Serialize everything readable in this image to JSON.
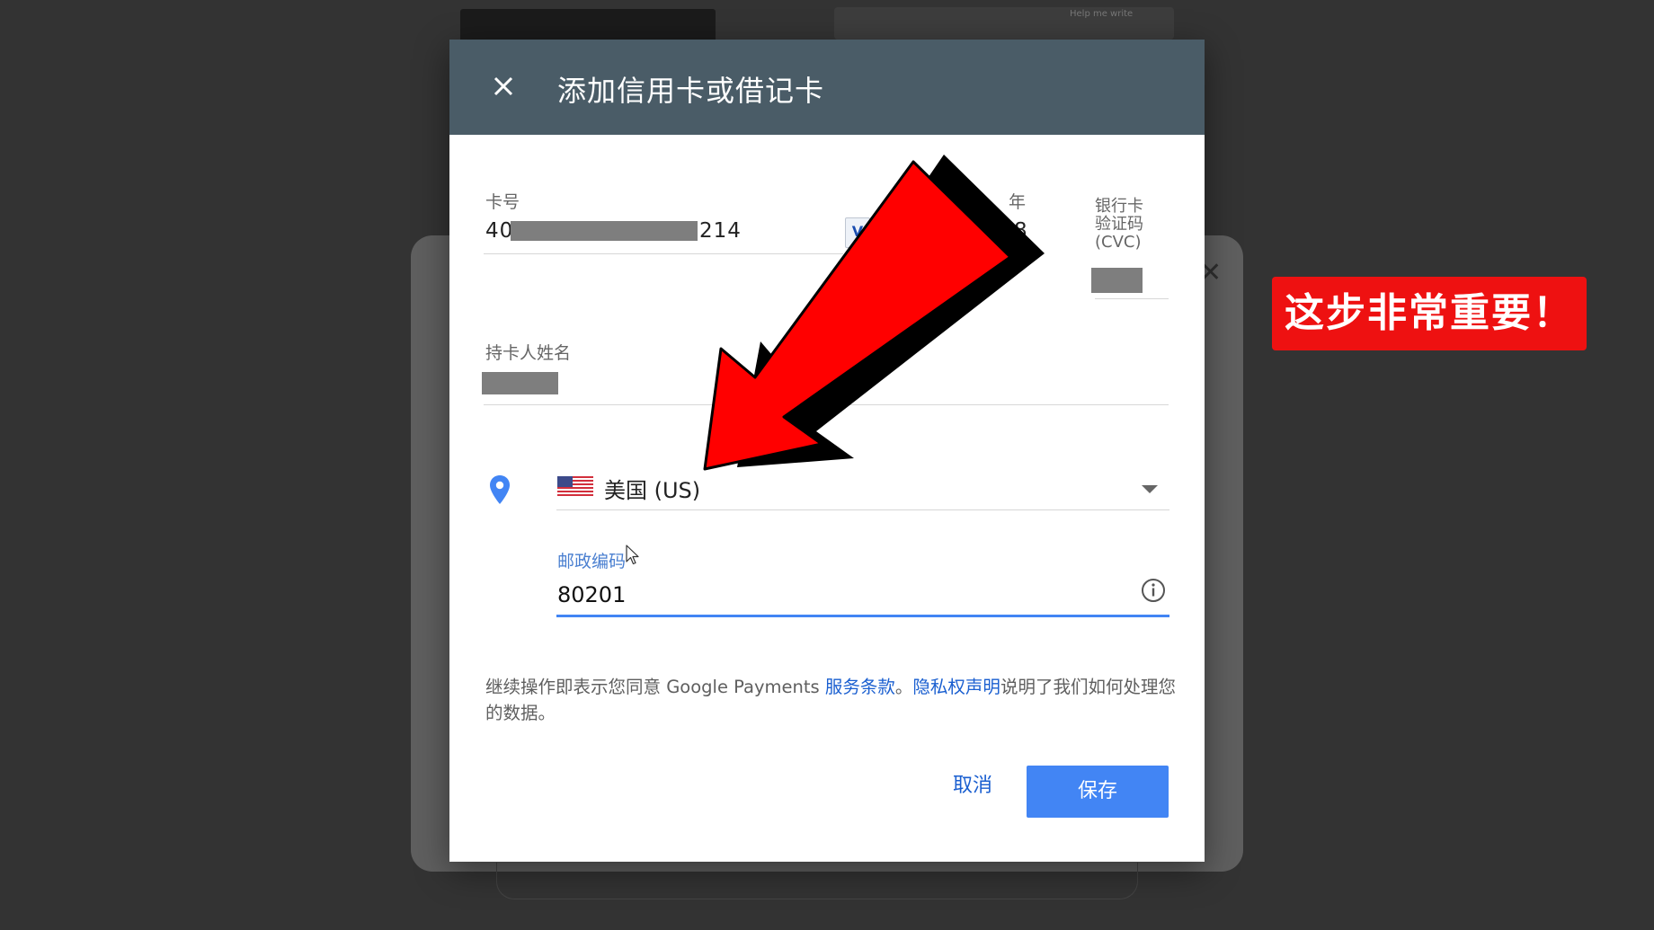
{
  "background": {
    "help_text": "Help me write"
  },
  "dialog": {
    "title": "添加信用卡或借记卡",
    "card_number_label": "卡号",
    "card_number_prefix": "40",
    "card_number_suffix": "214",
    "year_label": "年",
    "year_partial": "8",
    "cvc_label_line1": "银行卡",
    "cvc_label_line2": "验证码",
    "cvc_label_line3": "(CVC)",
    "cardholder_label": "持卡人姓名",
    "country_value": "美国 (US)",
    "zip_label": "邮政编码",
    "zip_value": "80201",
    "legal_before": "继续操作即表示您同意 Google Payments ",
    "terms_link": "服务条款",
    "legal_sep": "。",
    "privacy_link": "隐私权声明",
    "legal_after": "说明了我们如何处理您的数据。",
    "cancel_label": "取消",
    "save_label": "保存"
  },
  "annotation": {
    "callout_text": "这步非常重要！",
    "callout_color": "#ee1111",
    "arrow_color": "#ff0000"
  },
  "icons": {
    "close": "close-icon",
    "location": "location-pin-icon",
    "flag": "us-flag-icon",
    "dropdown": "dropdown-arrow-icon",
    "info": "info-icon",
    "cursor": "mouse-cursor-icon"
  },
  "colors": {
    "header": "#4a5c67",
    "accent": "#4285f4",
    "link": "#1a5fd0"
  }
}
